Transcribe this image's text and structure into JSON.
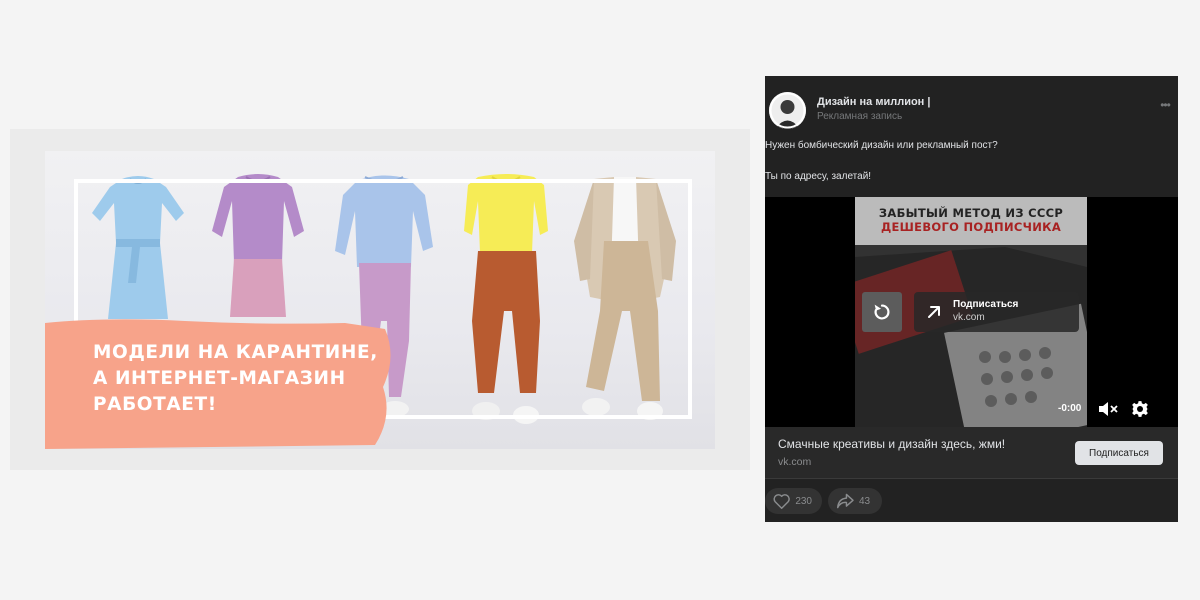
{
  "banner": {
    "headline_lines": [
      "МОДЕЛИ НА КАРАНТИНЕ,",
      "А ИНТЕРНЕТ-МАГАЗИН",
      "РАБОТАЕТ!"
    ],
    "accent_color": "#f7a38a"
  },
  "post": {
    "author": "Дизайн на миллион |",
    "ad_label": "Рекламная запись",
    "text_line_1": "Нужен бомбический дизайн или рекламный пост?",
    "text_line_2": "Ты по адресу, залетай!",
    "video": {
      "headline_line_1": "ЗАБЫТЫЙ МЕТОД ИЗ СССР",
      "headline_line_2": "ДЕШЕВОГО ПОДПИСЧИКА",
      "cta_title": "Подписаться",
      "cta_domain": "vk.com",
      "time": "-0:00"
    },
    "snippet": {
      "title": "Смачные креативы и дизайн здесь, жми!",
      "domain": "vk.com",
      "button_label": "Подписаться"
    },
    "likes": "230",
    "shares": "43"
  }
}
